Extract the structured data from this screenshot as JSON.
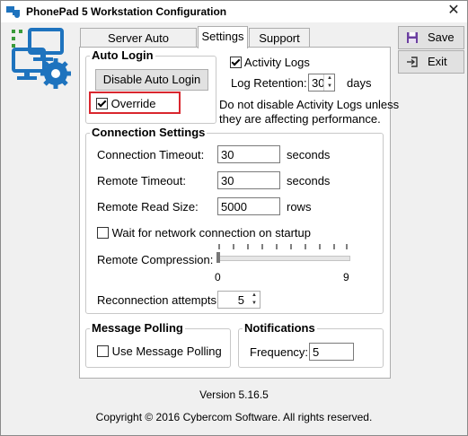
{
  "window": {
    "title": "PhonePad 5 Workstation Configuration",
    "close_glyph": "✕"
  },
  "tabs": [
    {
      "label": "Server Auto Discovery",
      "active": false
    },
    {
      "label": "Settings",
      "active": true
    },
    {
      "label": "Support",
      "active": false
    }
  ],
  "sidebar": {
    "save_label": "Save",
    "exit_label": "Exit"
  },
  "auto_login": {
    "title": "Auto Login",
    "disable_button": "Disable Auto Login",
    "override_label": "Override",
    "override_checked": true
  },
  "activity": {
    "activity_logs_label": "Activity Logs",
    "activity_logs_checked": true,
    "log_retention_label": "Log Retention:",
    "log_retention_value": "30",
    "log_retention_unit": "days",
    "note_line1": "Do not disable Activity Logs unless",
    "note_line2": "they are affecting performance."
  },
  "connection": {
    "title": "Connection Settings",
    "connection_timeout_label": "Connection Timeout:",
    "connection_timeout_value": "30",
    "connection_timeout_unit": "seconds",
    "remote_timeout_label": "Remote Timeout:",
    "remote_timeout_value": "30",
    "remote_timeout_unit": "seconds",
    "remote_read_size_label": "Remote Read Size:",
    "remote_read_size_value": "5000",
    "remote_read_size_unit": "rows",
    "wait_label": "Wait for network connection on startup",
    "wait_checked": false,
    "compression_label": "Remote Compression:",
    "compression_min": "0",
    "compression_max": "9",
    "compression_value": 0,
    "reconnect_label": "Reconnection attempts:",
    "reconnect_value": "5"
  },
  "message_polling": {
    "title": "Message Polling",
    "use_label": "Use Message Polling",
    "use_checked": false
  },
  "notifications": {
    "title": "Notifications",
    "frequency_label": "Frequency:",
    "frequency_value": "5"
  },
  "footer": {
    "version": "Version 5.16.5",
    "copyright": "Copyright © 2016 Cybercom Software. All rights reserved."
  },
  "colors": {
    "logo_blue": "#1e73be",
    "highlight_red": "#d9262e",
    "dots_green": "#3a9a3a"
  }
}
